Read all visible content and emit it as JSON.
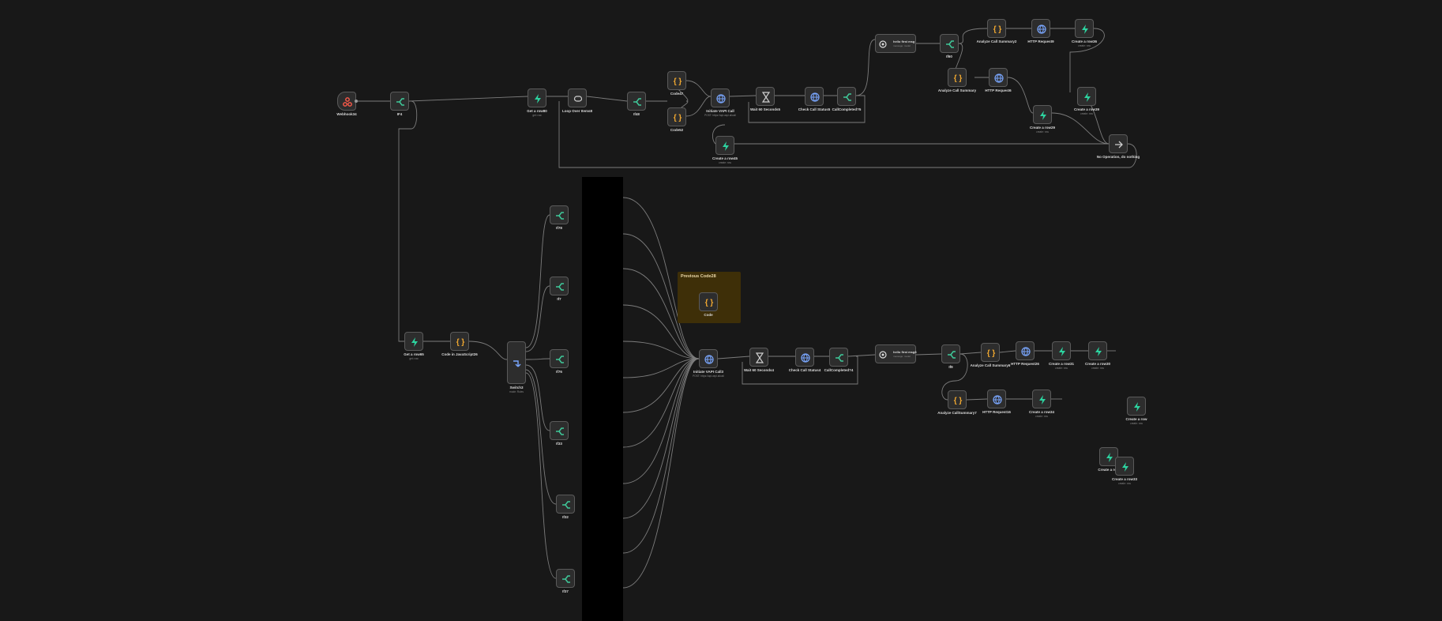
{
  "nodes": {
    "webhook": {
      "label": "Webhook34"
    },
    "if_top": {
      "label": "IF4"
    },
    "get_row_top": {
      "label": "Get a row80",
      "sub": "get: row"
    },
    "loop_over": {
      "label": "Loop Over Items8"
    },
    "if_loop": {
      "label": "If48"
    },
    "code47": {
      "label": "Code47"
    },
    "code52": {
      "label": "Code52"
    },
    "initiate_vapi_top": {
      "label": "Initiate VAPI Call",
      "sub": "POST: https://api.vapi.ai/call"
    },
    "wait_top": {
      "label": "Wait 60 Seconds5"
    },
    "check_status_top": {
      "label": "Check Call Status5"
    },
    "call_completed_top": {
      "label": "CallCompleted?5"
    },
    "create_row_top": {
      "label": "Create a row45",
      "sub": "create: row"
    },
    "hello_msg_top": {
      "label": "hello first msg",
      "sub": "message: model"
    },
    "if60": {
      "label": "If60"
    },
    "analyze_summary2": {
      "label": "Analyze Call Summary2"
    },
    "http_request9": {
      "label": "HTTP Request9"
    },
    "create_row36": {
      "label": "Create a row36",
      "sub": "create: row"
    },
    "analyze_summary": {
      "label": "Analyze Call Summary"
    },
    "http_request6": {
      "label": "HTTP Request6"
    },
    "create_row29": {
      "label": "Create a row29",
      "sub": "create: row"
    },
    "create_row39": {
      "label": "Create a row39",
      "sub": "create: row"
    },
    "no_op": {
      "label": "No Operation, do nothing"
    },
    "get_row_bottom": {
      "label": "Get a row65",
      "sub": "get: row"
    },
    "code_js": {
      "label": "Code in JavaScript26"
    },
    "switch": {
      "label": "Switch3",
      "sub": "mode: Rules"
    },
    "if8": {
      "label": "If78"
    },
    "if7": {
      "label": "If7"
    },
    "if6": {
      "label": "If76"
    },
    "if5": {
      "label": "If33"
    },
    "if4": {
      "label": "If32"
    },
    "if3": {
      "label": "If37"
    },
    "code_sticky": {
      "label": "Code"
    },
    "initiate_vapi_bottom": {
      "label": "Initiate VAPI Call3",
      "sub": "POST: https://api.vapi.ai/call"
    },
    "wait_bottom": {
      "label": "Wait 60 Seconds4"
    },
    "check_status_bottom": {
      "label": "Check Call Status4"
    },
    "call_completed_bottom": {
      "label": "CallCompleted?4"
    },
    "hello_msg_bottom": {
      "label": "hello first msg8",
      "sub": "message: model"
    },
    "if9": {
      "label": "If9"
    },
    "analyze_summary6": {
      "label": "Analyze Call Summary6"
    },
    "http_request26": {
      "label": "HTTP Request26"
    },
    "create_row31": {
      "label": "Create a row31",
      "sub": "create: row"
    },
    "create_row30": {
      "label": "Create a row30",
      "sub": "create: row"
    },
    "analyze_summary7": {
      "label": "Analyze CallSummary7"
    },
    "http_request16": {
      "label": "HTTP Request16"
    },
    "create_row34": {
      "label": "Create a row34",
      "sub": "create: row"
    },
    "create_row_a": {
      "label": "Create a row",
      "sub": "create: row"
    },
    "create_row_b": {
      "label": "Create a ro..."
    },
    "create_row33": {
      "label": "Create a row33",
      "sub": "create: row"
    }
  },
  "sticky": {
    "title": "Previous Code28"
  },
  "colors": {
    "canvas": "#181818",
    "node_bg": "#2d2d2d",
    "node_border": "#5a5a5a",
    "wire": "#7c7c7c",
    "airtable": "#2dd4a0",
    "logic": "#3fc99a",
    "code": "#f0a830",
    "http": "#7aa7ff",
    "webhook": "#ff5a4a",
    "sticky": "#3e2f08"
  }
}
